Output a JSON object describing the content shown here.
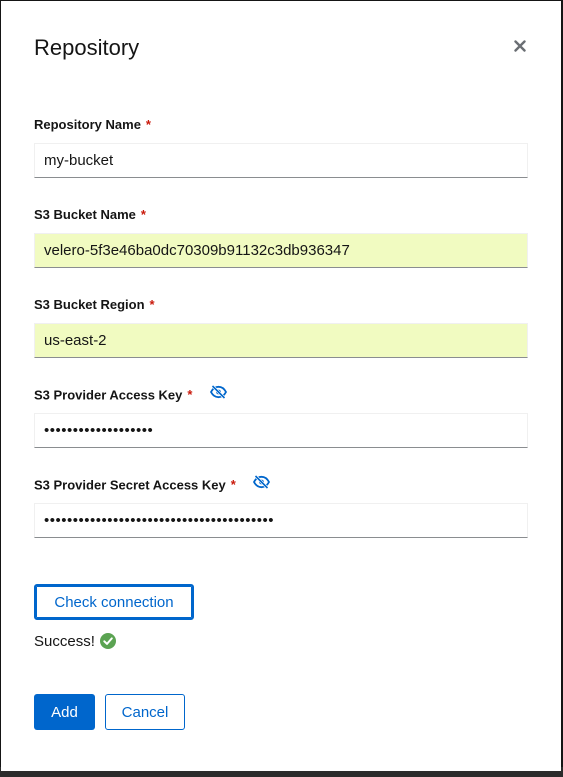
{
  "modal": {
    "title": "Repository",
    "close_icon": "close-icon"
  },
  "colors": {
    "primary": "#0066cc",
    "required": "#c9190b",
    "autofill_bg": "#f1fbc1",
    "success": "#3e8635"
  },
  "fields": {
    "repository_name": {
      "label": "Repository Name",
      "required": "*",
      "value": "my-bucket"
    },
    "bucket_name": {
      "label": "S3 Bucket Name",
      "required": "*",
      "value": "velero-5f3e46ba0dc70309b91132c3db936347"
    },
    "bucket_region": {
      "label": "S3 Bucket Region",
      "required": "*",
      "value": "us-east-2"
    },
    "access_key": {
      "label": "S3 Provider Access Key",
      "required": "*",
      "value": "•••••••••••••••••••",
      "icon": "eye-slash-icon"
    },
    "secret_key": {
      "label": "S3 Provider Secret Access Key",
      "required": "*",
      "value": "••••••••••••••••••••••••••••••••••••••••",
      "icon": "eye-slash-icon"
    }
  },
  "actions": {
    "check_connection": "Check connection",
    "status": "Success!",
    "status_icon": "check-circle-icon",
    "add": "Add",
    "cancel": "Cancel"
  }
}
